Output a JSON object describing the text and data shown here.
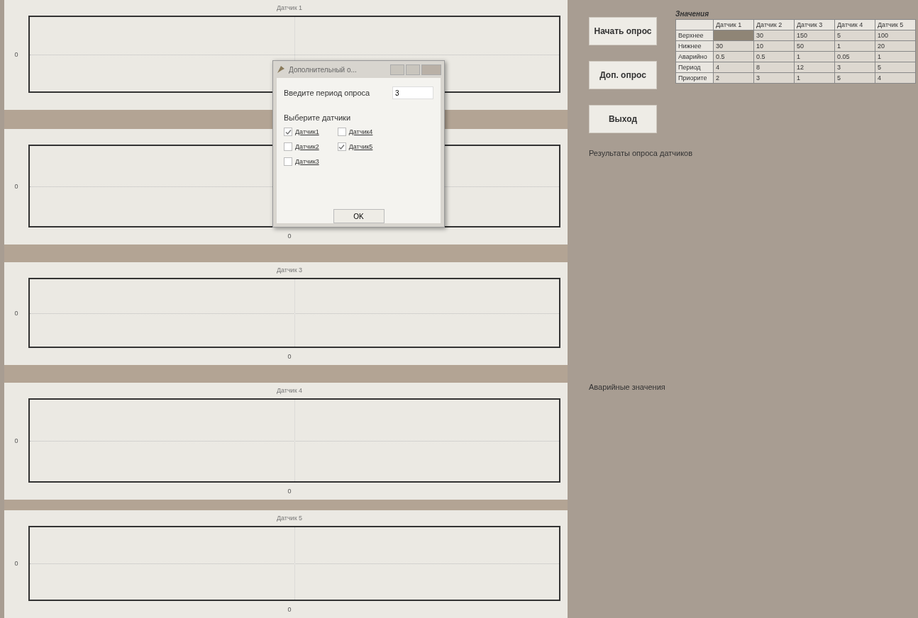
{
  "charts": [
    {
      "title": "Датчик 1",
      "ytick": "0"
    },
    {
      "ytick": "0",
      "xtick": "0"
    },
    {
      "title": "Датчик 3",
      "ytick": "0",
      "xtick": "0"
    },
    {
      "title": "Датчик 4",
      "ytick": "0",
      "xtick": "0"
    },
    {
      "title": "Датчик 5",
      "ytick": "0",
      "xtick": "0"
    }
  ],
  "buttons": [
    "Начать опрос",
    "Доп. опрос",
    "Выход"
  ],
  "table": {
    "title": "Значения",
    "columns": [
      "Датчик 1",
      "Датчик 2",
      "Датчик 3",
      "Датчик 4",
      "Датчик 5"
    ],
    "rows": [
      {
        "header": "Верхнее",
        "cells": [
          {
            "selected": true
          },
          {
            "text": "30",
            "selected": false
          },
          {
            "text": "150",
            "selected": false
          },
          {
            "text": "5",
            "selected": false
          },
          {
            "text": "100",
            "selected": false
          }
        ]
      },
      {
        "header": "Нижнее",
        "cells": [
          {
            "text": "30",
            "selected": false
          },
          {
            "text": "10",
            "selected": false
          },
          {
            "text": "50",
            "selected": false
          },
          {
            "text": "1",
            "selected": false
          },
          {
            "text": "20",
            "selected": false
          }
        ]
      },
      {
        "header": "Аварийно",
        "cells": [
          {
            "text": "0.5",
            "selected": false
          },
          {
            "text": "0.5",
            "selected": false
          },
          {
            "text": "1",
            "selected": false
          },
          {
            "text": "0.05",
            "selected": false
          },
          {
            "text": "1",
            "selected": false
          }
        ]
      },
      {
        "header": "Период",
        "cells": [
          {
            "text": "4",
            "selected": false
          },
          {
            "text": "8",
            "selected": false
          },
          {
            "text": "12",
            "selected": false
          },
          {
            "text": "3",
            "selected": false
          },
          {
            "text": "5",
            "selected": false
          }
        ]
      },
      {
        "header": "Приорите",
        "cells": [
          {
            "text": "2",
            "selected": false
          },
          {
            "text": "3",
            "selected": false
          },
          {
            "text": "1",
            "selected": false
          },
          {
            "text": "5",
            "selected": false
          },
          {
            "text": "4",
            "selected": false
          }
        ]
      }
    ]
  },
  "results_label": "Результаты опроса датчиков",
  "alarm_label": "Аварийные значения",
  "dialog": {
    "title": "Дополнительный о...",
    "period_label": "Введите период опроса",
    "period_value": "3",
    "sensors_label": "Выберите датчики",
    "checkboxes": [
      {
        "label": "Датчик1",
        "checked": true
      },
      {
        "label": "Датчик2",
        "checked": false
      },
      {
        "label": "Датчик3",
        "checked": false
      },
      {
        "label": "Датчик4",
        "checked": false
      },
      {
        "label": "Датчик5",
        "checked": true
      }
    ],
    "ok": "OK"
  }
}
